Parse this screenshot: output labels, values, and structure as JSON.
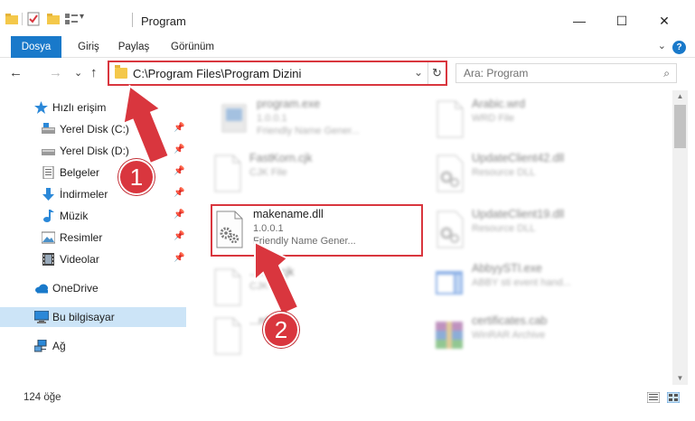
{
  "window": {
    "title": "Program",
    "minimize": "—",
    "maximize": "☐",
    "close": "✕"
  },
  "ribbon": {
    "tabs": [
      "Dosya",
      "Giriş",
      "Paylaş",
      "Görünüm"
    ],
    "help": "?",
    "collapse": "⌄"
  },
  "nav": {
    "back": "←",
    "forward": "→",
    "recent": "⌄",
    "up": "↑",
    "address": "C:\\Program Files\\Program Dizini",
    "address_dropdown": "⌄",
    "refresh": "↻",
    "search_placeholder": "Ara: Program",
    "search_icon": "⌕"
  },
  "sidebar": {
    "items": [
      {
        "label": "Hızlı erişim",
        "icon": "star-icon"
      },
      {
        "label": "Yerel Disk (C:)",
        "icon": "drive-icon",
        "pinned": true
      },
      {
        "label": "Yerel Disk (D:)",
        "icon": "drive-icon",
        "pinned": true
      },
      {
        "label": "Belgeler",
        "icon": "documents-icon",
        "pinned": true
      },
      {
        "label": "İndirmeler",
        "icon": "downloads-icon",
        "pinned": true
      },
      {
        "label": "Müzik",
        "icon": "music-icon",
        "pinned": true
      },
      {
        "label": "Resimler",
        "icon": "pictures-icon",
        "pinned": true
      },
      {
        "label": "Videolar",
        "icon": "videos-icon",
        "pinned": true
      },
      {
        "label": "OneDrive",
        "icon": "cloud-icon"
      },
      {
        "label": "Bu bilgisayar",
        "icon": "computer-icon",
        "selected": true
      },
      {
        "label": "Ağ",
        "icon": "network-icon"
      }
    ],
    "pin_glyph": "📌"
  },
  "files": {
    "left": [
      {
        "name": "program.exe",
        "line1": "1.0.0.1",
        "line2": "Friendly Name Gener...",
        "icon": "exe-icon"
      },
      {
        "name": "FastKorn.cjk",
        "line1": "CJK File",
        "line2": "",
        "icon": "file-icon"
      },
      {
        "name": "makename.dll",
        "line1": "1.0.0.1",
        "line2": "Friendly Name Gener...",
        "icon": "dll-gear-icon",
        "highlighted": true
      },
      {
        "name": "...nml.cjk",
        "line1": "CJK File",
        "line2": "",
        "icon": "file-icon"
      },
      {
        "name": "...rd",
        "line1": "",
        "line2": "",
        "icon": "file-icon"
      }
    ],
    "right": [
      {
        "name": "Arabic.wrd",
        "line1": "WRD File",
        "line2": "",
        "icon": "file-icon"
      },
      {
        "name": "UpdateClient42.dll",
        "line1": "Resource DLL",
        "line2": "",
        "icon": "dll-gear-icon"
      },
      {
        "name": "UpdateClient19.dll",
        "line1": "Resource DLL",
        "line2": "",
        "icon": "dll-gear-icon"
      },
      {
        "name": "AbbyySTI.exe",
        "line1": "ABBY sti event hand...",
        "line2": "",
        "icon": "app-window-icon"
      },
      {
        "name": "certificates.cab",
        "line1": "WinRAR Archive",
        "line2": "",
        "icon": "archive-icon"
      }
    ]
  },
  "status": {
    "count": "124 öğe"
  },
  "callouts": [
    {
      "number": "1"
    },
    {
      "number": "2"
    }
  ],
  "colors": {
    "accent": "#1979ca",
    "callout": "#d9363e",
    "selected": "#cce4f7"
  }
}
